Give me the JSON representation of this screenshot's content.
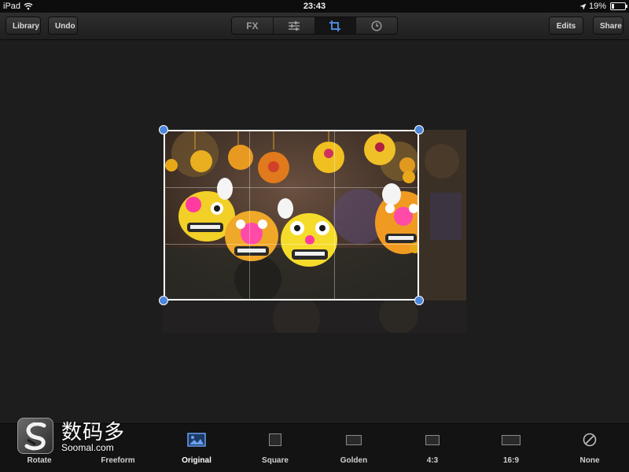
{
  "status_bar": {
    "device": "iPad",
    "time": "23:43",
    "battery": "19%",
    "battery_level": 0.19
  },
  "toolbar": {
    "library_label": "Library",
    "undo_label": "Undo",
    "edits_label": "Edits",
    "share_label": "Share",
    "tabs": [
      {
        "label": "FX",
        "icon": "fx-icon",
        "active": false
      },
      {
        "label": "",
        "icon": "sliders-icon",
        "active": false
      },
      {
        "label": "",
        "icon": "crop-icon",
        "active": true
      },
      {
        "label": "",
        "icon": "clock-icon",
        "active": false
      }
    ]
  },
  "crop_presets": [
    {
      "label": "Rotate",
      "icon": "rotate-icon"
    },
    {
      "label": "Freeform",
      "icon": "freeform-icon"
    },
    {
      "label": "Original",
      "icon": "photo-icon",
      "active": true
    },
    {
      "label": "Square",
      "icon": "square-icon"
    },
    {
      "label": "Golden",
      "icon": "golden-icon"
    },
    {
      "label": "4:3",
      "icon": "ratio-4-3-icon"
    },
    {
      "label": "16:9",
      "icon": "ratio-16-9-icon"
    },
    {
      "label": "None",
      "icon": "none-icon"
    }
  ],
  "watermark": {
    "title": "数码多",
    "url": "Soomal.com"
  },
  "colors": {
    "accent": "#4d86d9",
    "active_label": "#ffffff",
    "label": "#cfcfcf"
  }
}
